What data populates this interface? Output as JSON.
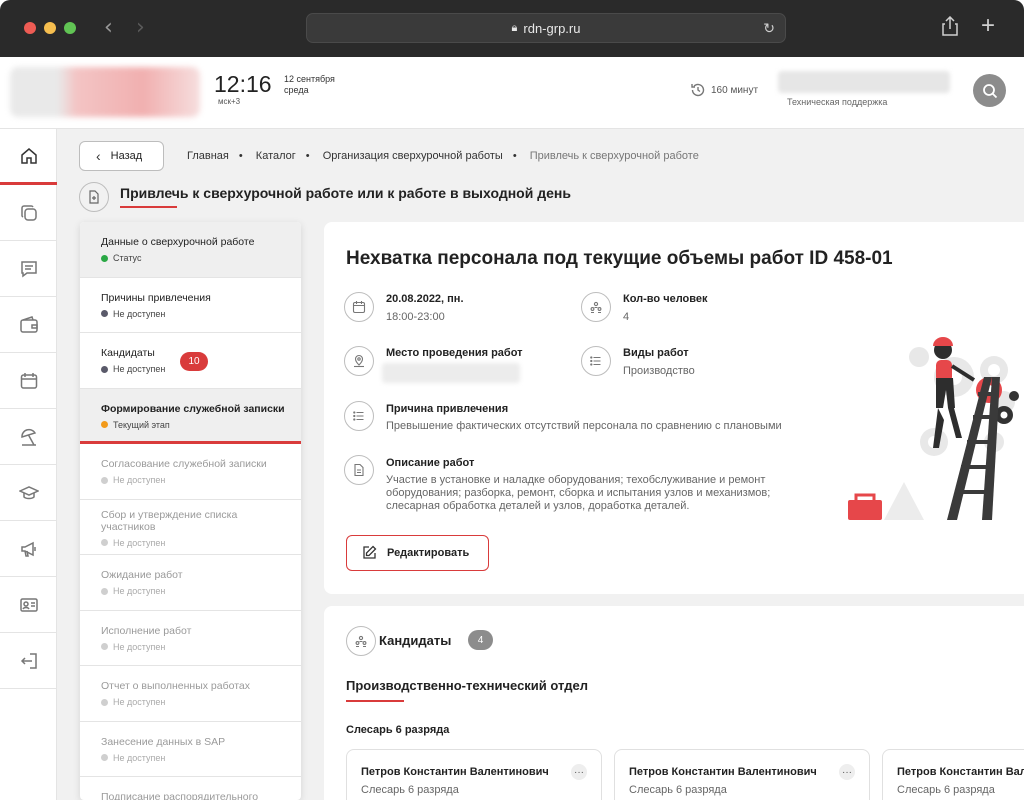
{
  "browser": {
    "url": "rdn-grp.ru",
    "colors": {
      "close": "#ee5c54",
      "minimize": "#f6be4f",
      "maximize": "#61c454"
    }
  },
  "header": {
    "time": "12:16",
    "timezone": "мск+3",
    "date_line1": "12 сентября",
    "date_line2": "среда",
    "minutes": "160 минут",
    "support": "Техническая поддержка"
  },
  "sidebar": {
    "items": [
      {
        "icon": "home-icon"
      },
      {
        "icon": "copy-icon"
      },
      {
        "icon": "chat-icon"
      },
      {
        "icon": "wallet-icon"
      },
      {
        "icon": "calendar-icon"
      },
      {
        "icon": "umbrella-icon"
      },
      {
        "icon": "graduation-icon"
      },
      {
        "icon": "megaphone-icon"
      },
      {
        "icon": "id-card-icon"
      },
      {
        "icon": "logout-icon"
      }
    ]
  },
  "nav": {
    "back_label": "Назад",
    "breadcrumbs": [
      "Главная",
      "Каталог",
      "Организация сверхурочной работы",
      "Привлечь к сверхурочной работе"
    ]
  },
  "page": {
    "title": "Привлечь к сверхурочной работе или к работе в выходной день"
  },
  "steps": [
    {
      "title": "Данные о сверхурочной работе",
      "status": "Статус",
      "dot": "#2aa845"
    },
    {
      "title": "Причины привлечения",
      "status": "Не доступен",
      "dot": "#5a5a6a"
    },
    {
      "title": "Кандидаты",
      "status": "Не доступен",
      "dot": "#5a5a6a",
      "badge": "10"
    },
    {
      "title": "Формирование служебной записки",
      "status": "Текущий этап",
      "dot": "#f29a1a"
    },
    {
      "title": "Согласование служебной записки",
      "status": "Не доступен",
      "dot": "#cfcfcf"
    },
    {
      "title": "Сбор и утверждение списка участников",
      "status": "Не доступен",
      "dot": "#cfcfcf"
    },
    {
      "title": "Ожидание работ",
      "status": "Не доступен",
      "dot": "#cfcfcf"
    },
    {
      "title": "Исполнение работ",
      "status": "Не доступен",
      "dot": "#cfcfcf"
    },
    {
      "title": "Отчет о выполненных работах",
      "status": "Не доступен",
      "dot": "#cfcfcf"
    },
    {
      "title": "Занесение данных в SAP",
      "status": "Не доступен",
      "dot": "#cfcfcf"
    },
    {
      "title": "Подписание распорядительного",
      "status": "",
      "dot": ""
    }
  ],
  "request": {
    "title": "Нехватка персонала под текущие объемы работ ID 458-01",
    "date_label": "20.08.2022, пн.",
    "date_value": "18:00-23:00",
    "count_label": "Кол-во человек",
    "count_value": "4",
    "place_label": "Место проведения работ",
    "work_type_label": "Виды работ",
    "work_type_value": "Производство",
    "reason_label": "Причина привлечения",
    "reason_value": "Превышение фактических отсутствий персонала по сравнению с плановыми",
    "desc_label": "Описание работ",
    "desc_line1": "Участие в установке и наладке оборудования; техобслуживание и ремонт",
    "desc_line2": "оборудования;  разборка, ремонт, сборка и испытания узлов и механизмов;",
    "desc_line3": "слесарная обработка деталей и узлов, доработка деталей.",
    "edit_label": "Редактировать"
  },
  "candidates": {
    "title": "Кандидаты",
    "count": "4",
    "department": "Производственно-технический отдел",
    "role": "Слесарь 6 разряда",
    "people": [
      {
        "name": "Петров Константин Валентинович",
        "role": "Слесарь 6 разряда"
      },
      {
        "name": "Петров Константин Валентинович",
        "role": "Слесарь 6 разряда"
      },
      {
        "name": "Петров Константин Валентинович",
        "role": "Слесарь 6 разряда"
      }
    ]
  },
  "accent": "#d93b3b"
}
